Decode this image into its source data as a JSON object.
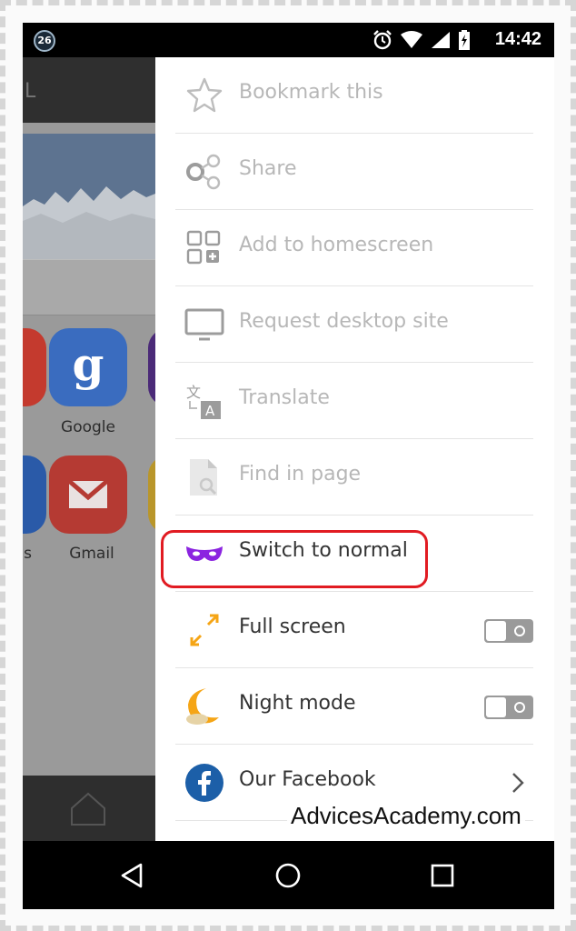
{
  "status_bar": {
    "notification_count": "26",
    "time": "14:42",
    "icons": [
      "alarm-icon",
      "wifi-icon",
      "signal-icon",
      "battery-charging-icon"
    ]
  },
  "background_page": {
    "url_fragment": "L",
    "tiles": [
      {
        "name": "google",
        "label": "Google",
        "letter": "g",
        "color": "#3a78d8"
      },
      {
        "name": "gmail",
        "label": "Gmail",
        "color": "#d33b33"
      }
    ],
    "partial_label": "s"
  },
  "menu": {
    "items": [
      {
        "id": "bookmark",
        "label": "Bookmark this",
        "icon": "star-outline-icon",
        "enabled": false
      },
      {
        "id": "share",
        "label": "Share",
        "icon": "share-icon",
        "enabled": false
      },
      {
        "id": "homescreen",
        "label": "Add to homescreen",
        "icon": "add-to-homescreen-icon",
        "enabled": false
      },
      {
        "id": "desktop",
        "label": "Request desktop site",
        "icon": "monitor-icon",
        "enabled": false
      },
      {
        "id": "translate",
        "label": "Translate",
        "icon": "translate-icon",
        "enabled": false
      },
      {
        "id": "find",
        "label": "Find in page",
        "icon": "find-in-page-icon",
        "enabled": false
      },
      {
        "id": "switch_normal",
        "label": "Switch to normal",
        "icon": "incognito-mask-icon",
        "enabled": true,
        "icon_color": "#8b24e0"
      },
      {
        "id": "fullscreen",
        "label": "Full screen",
        "icon": "expand-arrows-icon",
        "enabled": true,
        "icon_color": "#f5a516",
        "toggle": "off"
      },
      {
        "id": "nightmode",
        "label": "Night mode",
        "icon": "moon-cloud-icon",
        "enabled": true,
        "icon_color": "#f5a516",
        "toggle": "off"
      },
      {
        "id": "facebook",
        "label": "Our Facebook",
        "icon": "facebook-icon",
        "enabled": true,
        "icon_color": "#1c5fa8"
      }
    ]
  },
  "annotation": {
    "highlight_color": "#e11b22",
    "watermark": "AdvicesAcademy.com"
  },
  "nav_bar": {
    "buttons": [
      "back-icon",
      "home-icon",
      "recents-icon"
    ]
  }
}
